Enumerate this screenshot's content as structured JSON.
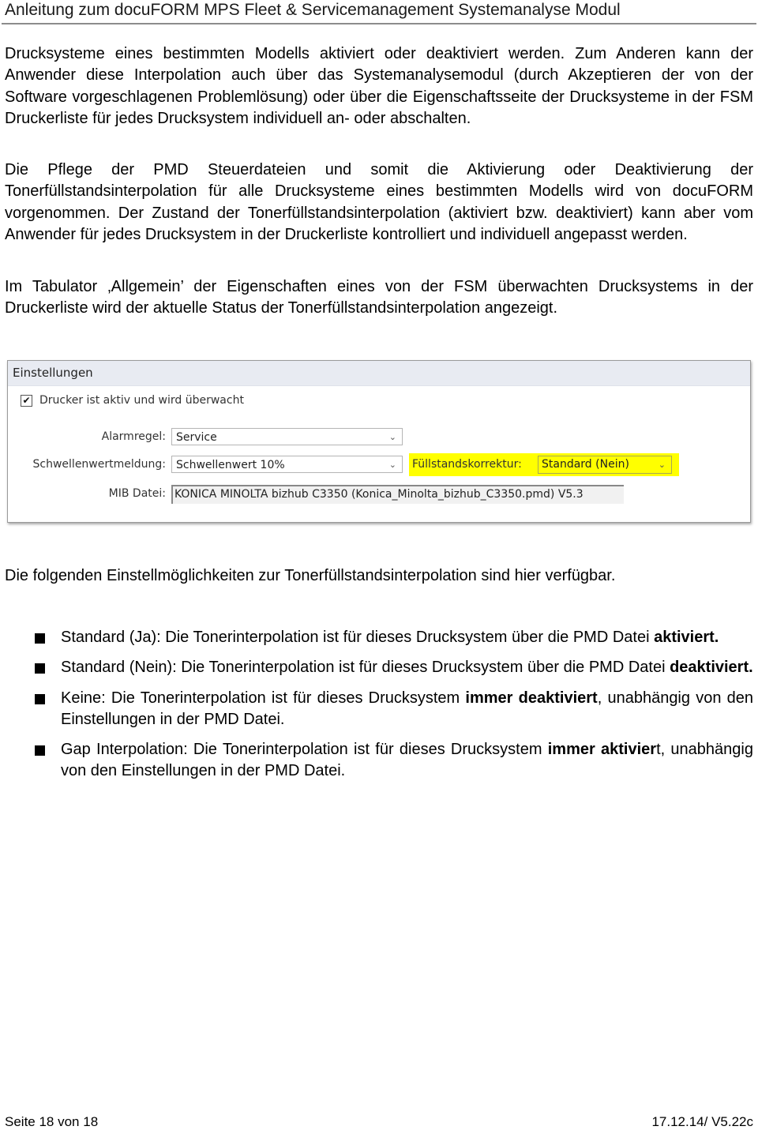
{
  "header": {
    "title": "Anleitung zum docuFORM MPS Fleet & Servicemanagement Systemanalyse Modul"
  },
  "paragraphs": [
    "Drucksysteme eines bestimmten Modells aktiviert oder deaktiviert werden. Zum Anderen kann der Anwender diese Interpolation auch über das Systemanalysemodul (durch Akzeptieren der von der Software vorgeschlagenen Problemlösung) oder über die Eigenschaftsseite der Drucksysteme in der FSM Druckerliste für jedes Drucksystem individuell an- oder abschalten.",
    "Die Pflege der PMD Steuerdateien und somit die Aktivierung oder Deaktivierung der Tonerfüllstandsinterpolation für alle Drucksysteme eines bestimmten Modells wird von docuFORM vorgenommen. Der Zustand der Tonerfüllstandsinterpolation (aktiviert bzw. deaktiviert) kann aber vom Anwender für jedes Drucksystem in der Druckerliste kontrolliert und individuell angepasst werden.",
    "Im Tabulator ‚Allgemein’ der Eigenschaften eines von der FSM überwachten Drucksystems in der Druckerliste wird der aktuelle Status der Tonerfüllstandsinterpolation angezeigt.",
    "Die folgenden Einstellmöglichkeiten zur Tonerfüllstandsinterpolation sind hier verfügbar."
  ],
  "settings_panel": {
    "title": "Einstellungen",
    "active_checkbox": {
      "label": "Drucker ist aktiv und wird überwacht",
      "checked": true,
      "check_glyph": "✔"
    },
    "alarm_rule": {
      "label": "Alarmregel:",
      "value": "Service"
    },
    "threshold": {
      "label": "Schwellenwertmeldung:",
      "value": "Schwellenwert 10%"
    },
    "fill_correction": {
      "label": "Füllstandskorrektur:",
      "value": "Standard (Nein)",
      "highlight_color": "#ffff00"
    },
    "mib_file": {
      "label": "MIB Datei:",
      "value": "KONICA MINOLTA bizhub C3350 (Konica_Minolta_bizhub_C3350.pmd) V5.3"
    },
    "chevron_glyph": "⌄"
  },
  "bullets": [
    {
      "pre": "Standard (Ja): Die Tonerinterpolation ist für dieses Drucksystem über die PMD Datei ",
      "bold": "aktiviert.",
      "post": ""
    },
    {
      "pre": "Standard (Nein): Die Tonerinterpolation ist für dieses Drucksystem über die PMD Datei ",
      "bold": "deaktiviert.",
      "post": ""
    },
    {
      "pre": "Keine: Die Tonerinterpolation ist für dieses Drucksystem ",
      "bold": "immer deaktiviert",
      "post": ", unabhängig von den Einstellungen in der PMD Datei."
    },
    {
      "pre": "Gap Interpolation: Die Tonerinterpolation ist für dieses Drucksystem ",
      "bold": "immer aktivier",
      "post": "t, unabhängig von den Einstellungen in der PMD Datei."
    }
  ],
  "footer": {
    "page": "Seite 18 von 18",
    "version": "17.12.14/ V5.22c"
  }
}
